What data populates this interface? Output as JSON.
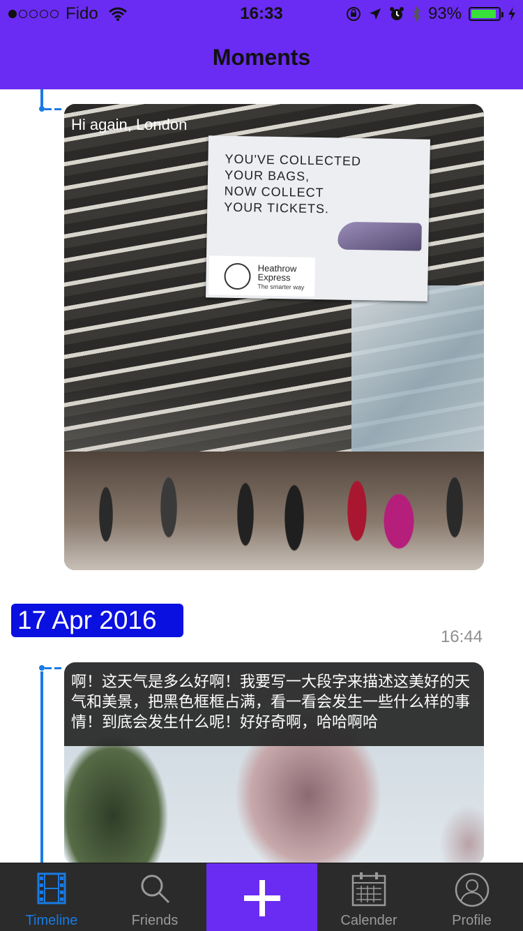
{
  "status_bar": {
    "carrier": "Fido",
    "time": "16:33",
    "battery_percent": "93%",
    "battery_level": 0.93
  },
  "nav": {
    "title": "Moments"
  },
  "feed": {
    "moments": [
      {
        "caption": "Hi again, London",
        "photo": {
          "sign_text": "YOU'VE COLLECTED\nYOUR BAGS,\nNOW COLLECT\nYOUR TICKETS.",
          "brand_name": "Heathrow\nExpress",
          "brand_tagline": "The smarter way"
        }
      }
    ],
    "date_group": {
      "date": "17 Apr 2016",
      "time": "16:44",
      "moment_text": "啊！这天气是多么好啊！我要写一大段字来描述这美好的天气和美景，把黑色框框占满，看一看会发生一些什么样的事情！到底会发生什么呢！好好奇啊，哈哈啊哈"
    }
  },
  "tabbar": {
    "tabs": [
      {
        "label": "Timeline",
        "icon": "film-icon",
        "active": true
      },
      {
        "label": "Friends",
        "icon": "search-icon"
      },
      {
        "label": "",
        "icon": "plus-icon"
      },
      {
        "label": "Calender",
        "icon": "calendar-icon"
      },
      {
        "label": "Profile",
        "icon": "person-icon"
      }
    ]
  },
  "colors": {
    "accent": "#6a2cf2",
    "timeline": "#1a7be3",
    "date_badge": "#0a10e0",
    "tabbar": "#2b2b2b"
  }
}
